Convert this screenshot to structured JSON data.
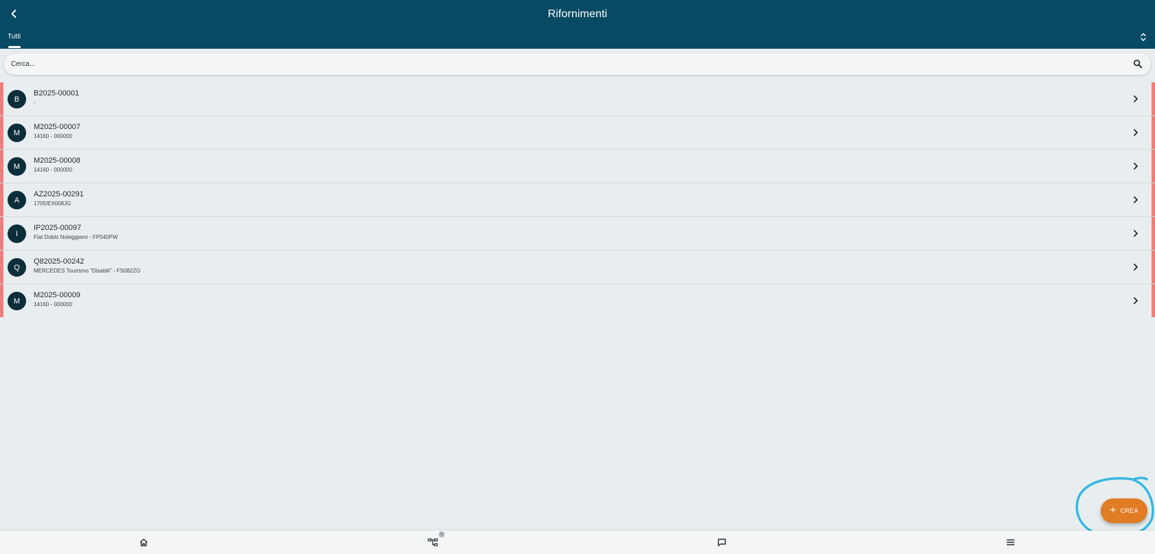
{
  "header": {
    "title": "Rifornimenti",
    "tabs": [
      {
        "label": "Tutti",
        "active": true
      }
    ],
    "color": "#084a63"
  },
  "search": {
    "placeholder": "Cerca...",
    "value": ""
  },
  "list": {
    "accent_color": "#ef7f7f",
    "items": [
      {
        "initial": "B",
        "title": "B2025-00001",
        "subtitle": "-"
      },
      {
        "initial": "M",
        "title": "M2025-00007",
        "subtitle": "14160 - 000000"
      },
      {
        "initial": "M",
        "title": "M2025-00008",
        "subtitle": "14160 - 000000"
      },
      {
        "initial": "A",
        "title": "AZ2025-00291",
        "subtitle": "1705/EX008JG"
      },
      {
        "initial": "I",
        "title": "IP2025-00097",
        "subtitle": "Fiat Doblo Noleggiami - FP040PW"
      },
      {
        "initial": "Q",
        "title": "Q82025-00242",
        "subtitle": "MERCEDES Tourismo \"Disabili\" - FS082ZG"
      },
      {
        "initial": "M",
        "title": "M2025-00009",
        "subtitle": "14160 - 000000"
      }
    ]
  },
  "fab": {
    "icon": "plus-icon",
    "label": "CREA",
    "color": "#e07c24"
  },
  "bottom_nav": {
    "items": [
      {
        "icon": "home-icon"
      },
      {
        "icon": "sitemap-icon",
        "badge": "0"
      },
      {
        "icon": "chat-icon"
      },
      {
        "icon": "menu-icon"
      }
    ]
  }
}
